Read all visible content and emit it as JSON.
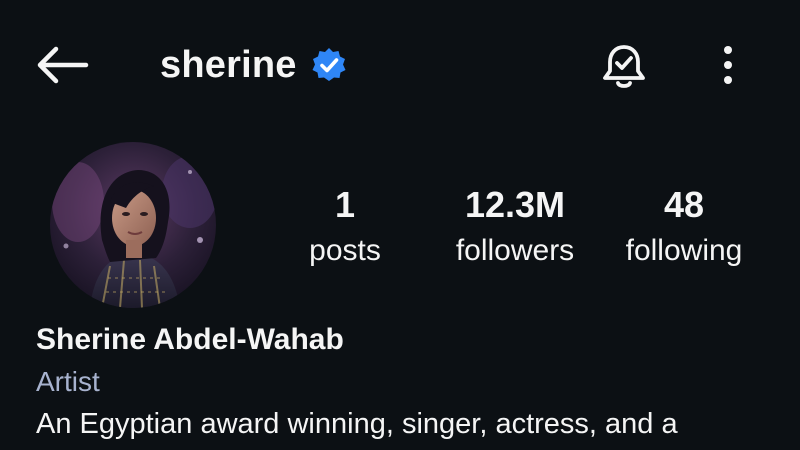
{
  "header": {
    "username": "sherine",
    "verified": true,
    "icons": {
      "back": "arrow-left-icon",
      "verified": "verified-badge-icon",
      "notifications": "bell-check-icon",
      "more": "more-vertical-icon"
    }
  },
  "stats": [
    {
      "value": "1",
      "label": "posts"
    },
    {
      "value": "12.3M",
      "label": "followers"
    },
    {
      "value": "48",
      "label": "following"
    }
  ],
  "bio": {
    "full_name": "Sherine Abdel-Wahab",
    "category": "Artist",
    "text": "An Egyptian award winning, singer, actress, and a"
  },
  "colors": {
    "background": "#0c1014",
    "text": "#f5f5f5",
    "category": "#a8b3cf",
    "verified_badge": "#2f86f6"
  }
}
